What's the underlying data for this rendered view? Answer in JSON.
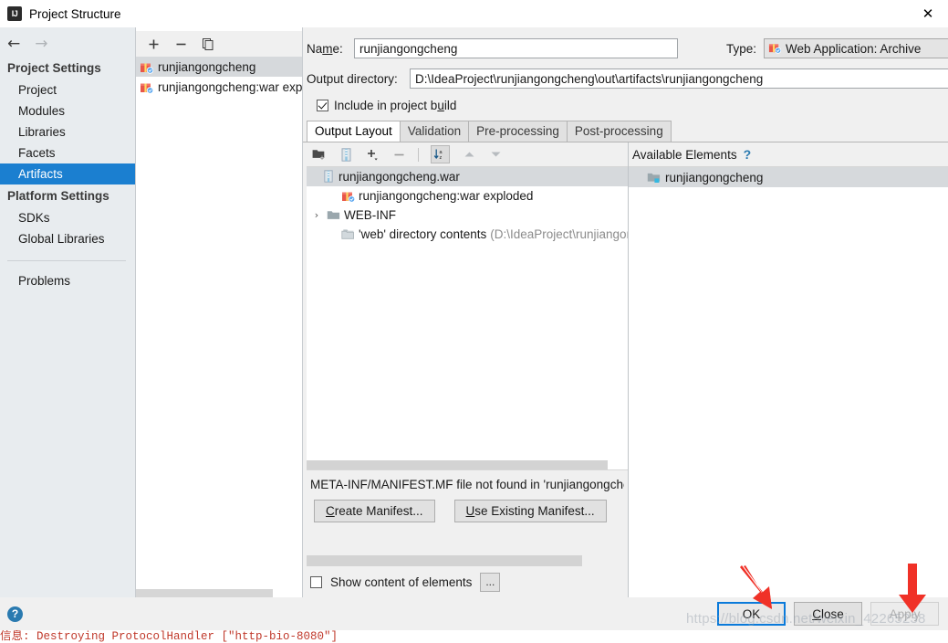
{
  "window": {
    "title": "Project Structure",
    "logo_icon": "intellij-idea-logo",
    "close_icon": "close-icon"
  },
  "nav": {
    "back_icon": "arrow-left-icon",
    "forward_icon": "arrow-right-icon",
    "groups": [
      {
        "label": "Project Settings",
        "items": [
          {
            "label": "Project",
            "selected": false
          },
          {
            "label": "Modules",
            "selected": false
          },
          {
            "label": "Libraries",
            "selected": false
          },
          {
            "label": "Facets",
            "selected": false
          },
          {
            "label": "Artifacts",
            "selected": true
          }
        ]
      },
      {
        "label": "Platform Settings",
        "items": [
          {
            "label": "SDKs",
            "selected": false
          },
          {
            "label": "Global Libraries",
            "selected": false
          }
        ]
      }
    ],
    "problems": {
      "label": "Problems"
    }
  },
  "artifacts_panel": {
    "toolbar": [
      {
        "name": "add-artifact-button",
        "glyph": "+"
      },
      {
        "name": "remove-artifact-button",
        "glyph": "−"
      },
      {
        "name": "copy-artifact-button",
        "glyph": "copy-icon"
      }
    ],
    "items": [
      {
        "label": "runjiangongcheng",
        "icon": "artifact-icon",
        "selected": true
      },
      {
        "label": "runjiangongcheng:war exploded",
        "icon": "artifact-icon",
        "selected": false
      }
    ]
  },
  "form": {
    "name_label": "Name:",
    "name_label_mnemonic": "m",
    "name_value": "runjiangongcheng",
    "type_label": "Type:",
    "type_value": "Web Application: Archive",
    "type_icon": "artifact-icon",
    "type_caret_icon": "chevron-down-icon",
    "output_dir_label": "Output directory:",
    "output_dir_value": "D:\\IdeaProject\\runjiangongcheng\\out\\artifacts\\runjiangongcheng",
    "browse_icon": "folder-browse-icon",
    "include_in_build_label": "Include in project build",
    "include_in_build_checked": true
  },
  "tabs": [
    {
      "label": "Output Layout",
      "active": true
    },
    {
      "label": "Validation",
      "active": false
    },
    {
      "label": "Pre-processing",
      "active": false
    },
    {
      "label": "Post-processing",
      "active": false
    }
  ],
  "layout_panel": {
    "toolbar": [
      {
        "name": "add-directory-button",
        "glyph": "folder-add-icon"
      },
      {
        "name": "add-archive-button",
        "glyph": "archive-icon"
      },
      {
        "name": "add-element-button",
        "glyph": "+"
      },
      {
        "name": "remove-element-button",
        "glyph": "−"
      },
      {
        "name": "sort-button",
        "glyph": "sort-az-icon"
      },
      {
        "name": "move-up-button",
        "glyph": "triangle-up-icon"
      },
      {
        "name": "move-down-button",
        "glyph": "triangle-down-icon"
      }
    ],
    "tree": [
      {
        "label": "runjiangongcheng.war",
        "icon": "archive-icon",
        "indent": 0,
        "expander": "",
        "selected": true,
        "suffix": ""
      },
      {
        "label": "runjiangongcheng:war exploded",
        "icon": "artifact-icon",
        "indent": 1,
        "expander": "",
        "selected": false,
        "suffix": ""
      },
      {
        "label": "WEB-INF",
        "icon": "folder-icon",
        "indent": 1,
        "expander": "›",
        "selected": false,
        "suffix": ""
      },
      {
        "label": "'web' directory contents",
        "icon": "folder-copy-icon",
        "indent": 1,
        "expander": "",
        "selected": false,
        "suffix": "(D:\\IdeaProject\\runjiangongch"
      }
    ],
    "manifest_message": "META-INF/MANIFEST.MF file not found in 'runjiangongcheng",
    "create_manifest_label": "Create Manifest...",
    "create_manifest_mnemonic": "C",
    "use_existing_manifest_label": "Use Existing Manifest...",
    "use_existing_manifest_mnemonic": "U"
  },
  "available_panel": {
    "header": "Available Elements",
    "help_icon": "help-question-icon",
    "items": [
      {
        "label": "runjiangongcheng",
        "icon": "module-folder-icon"
      }
    ]
  },
  "bottom_options": {
    "show_content_label": "Show content of elements",
    "show_content_checked": false,
    "more_button_label": "...",
    "more_button_name": "show-content-options-button"
  },
  "footer": {
    "help_icon": "help-circle-icon",
    "buttons": [
      {
        "label": "OK",
        "name": "ok-button",
        "style": "default",
        "disabled": false
      },
      {
        "label": "Close",
        "name": "close-button",
        "style": "normal",
        "disabled": false
      },
      {
        "label": "Apply",
        "name": "apply-button",
        "style": "disabled",
        "disabled": true
      }
    ]
  },
  "annotations": {
    "watermark": "https://blog.csdn.net/weixin_42265238",
    "arrow_color": "#f03127",
    "arrows": [
      {
        "name": "arrow-pointing-to-ok-button"
      },
      {
        "name": "arrow-pointing-to-apply-button"
      }
    ]
  },
  "console": {
    "text": "信息: Destroying ProtocolHandler [\"http-bio-8080\"]"
  },
  "colors": {
    "selection_blue": "#1b7fd0",
    "default_button_border": "#0a7ada",
    "dialog_bg": "#f0f0f0",
    "nav_bg": "#e8ecef",
    "console_red": "#c0392b"
  }
}
